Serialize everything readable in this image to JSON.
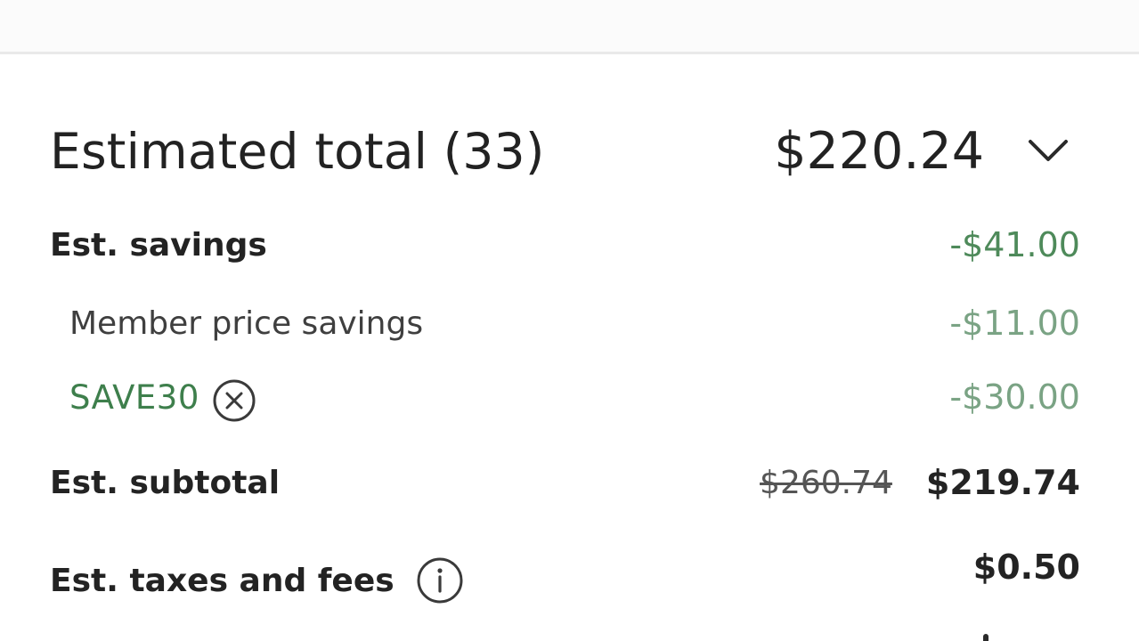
{
  "summary": {
    "total_label": "Estimated total (33)",
    "total_amount": "$220.24",
    "savings_label": "Est. savings",
    "savings_amount": "-$41.00",
    "member_savings_label": "Member price savings",
    "member_savings_amount": "-$11.00",
    "coupon_code": "SAVE30",
    "coupon_amount": "-$30.00",
    "subtotal_label": "Est. subtotal",
    "subtotal_original": "$260.74",
    "subtotal_amount": "$219.74",
    "taxes_label": "Est. taxes and fees",
    "taxes_amount": "$0.50"
  },
  "icons": {
    "expand": "chevron-down-icon",
    "remove_coupon": "close-circle-icon",
    "info": "info-icon"
  },
  "colors": {
    "savings_green": "#4e8a5a",
    "coupon_green": "#3e7f4c",
    "sub_savings_green": "#7aa384",
    "text_dark": "#222222"
  }
}
